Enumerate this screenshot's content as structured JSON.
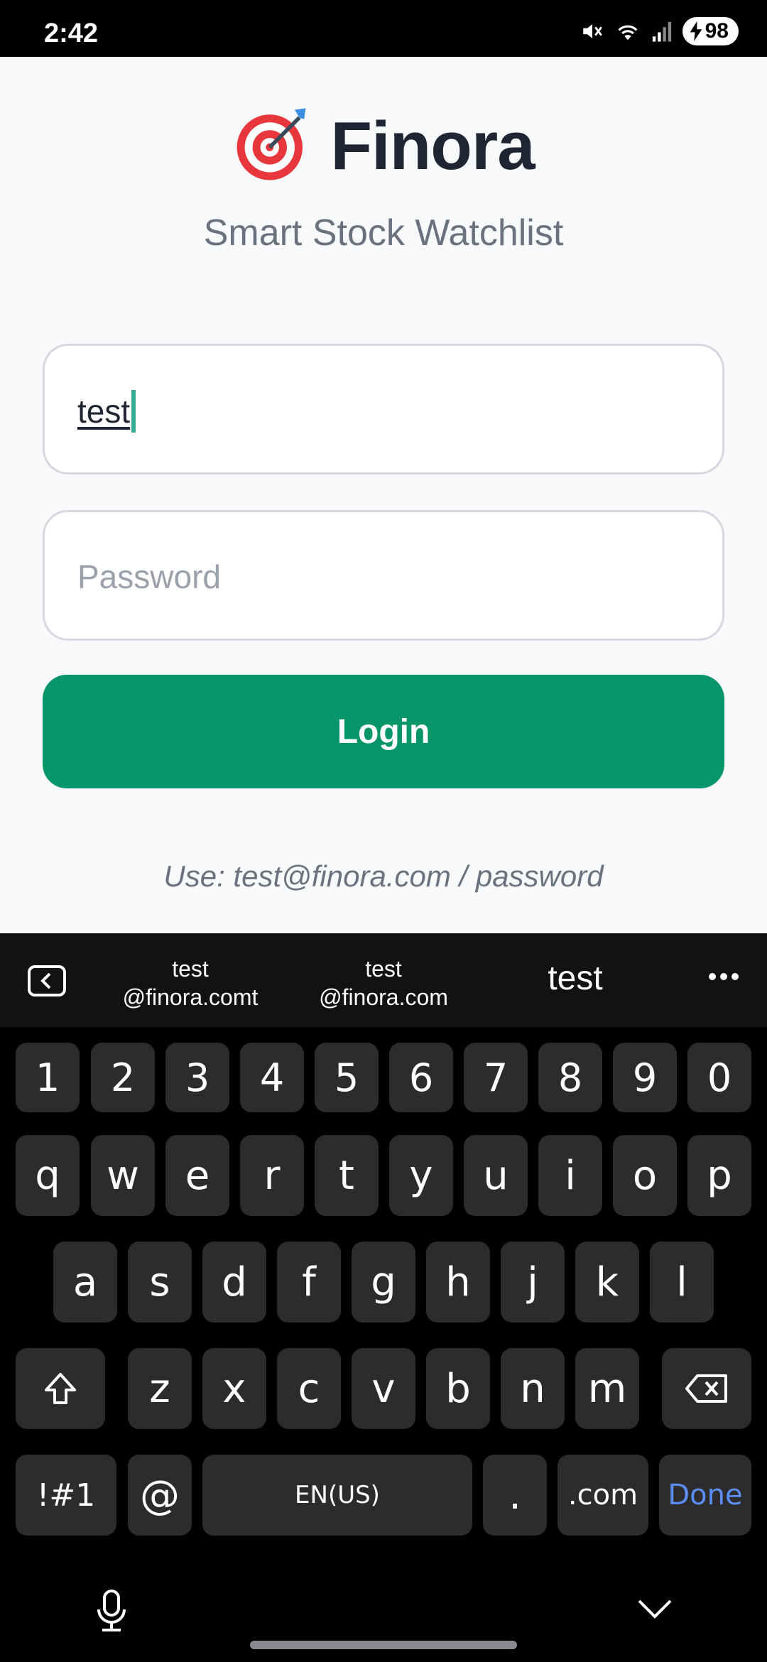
{
  "status_bar": {
    "time": "2:42",
    "battery": "98"
  },
  "app": {
    "brand_emoji": "🎯",
    "title": "Finora",
    "subtitle": "Smart Stock Watchlist",
    "email_value": "test",
    "password_placeholder": "Password",
    "login_label": "Login",
    "hint": "Use: test@finora.com / password"
  },
  "keyboard": {
    "suggestions": [
      {
        "line1": "test",
        "line2": "@finora.comt"
      },
      {
        "line1": "test",
        "line2": "@finora.com"
      },
      {
        "line1": "test"
      }
    ],
    "row_numbers": [
      "1",
      "2",
      "3",
      "4",
      "5",
      "6",
      "7",
      "8",
      "9",
      "0"
    ],
    "row1": [
      "q",
      "w",
      "e",
      "r",
      "t",
      "y",
      "u",
      "i",
      "o",
      "p"
    ],
    "row2": [
      "a",
      "s",
      "d",
      "f",
      "g",
      "h",
      "j",
      "k",
      "l"
    ],
    "row3": [
      "z",
      "x",
      "c",
      "v",
      "b",
      "n",
      "m"
    ],
    "symbols_label": "!#1",
    "at_label": "@",
    "space_label": "EN(US)",
    "period_label": ".",
    "dotcom_label": ".com",
    "done_label": "Done"
  },
  "colors": {
    "accent": "#079669",
    "done_blue": "#5a8ef2"
  }
}
